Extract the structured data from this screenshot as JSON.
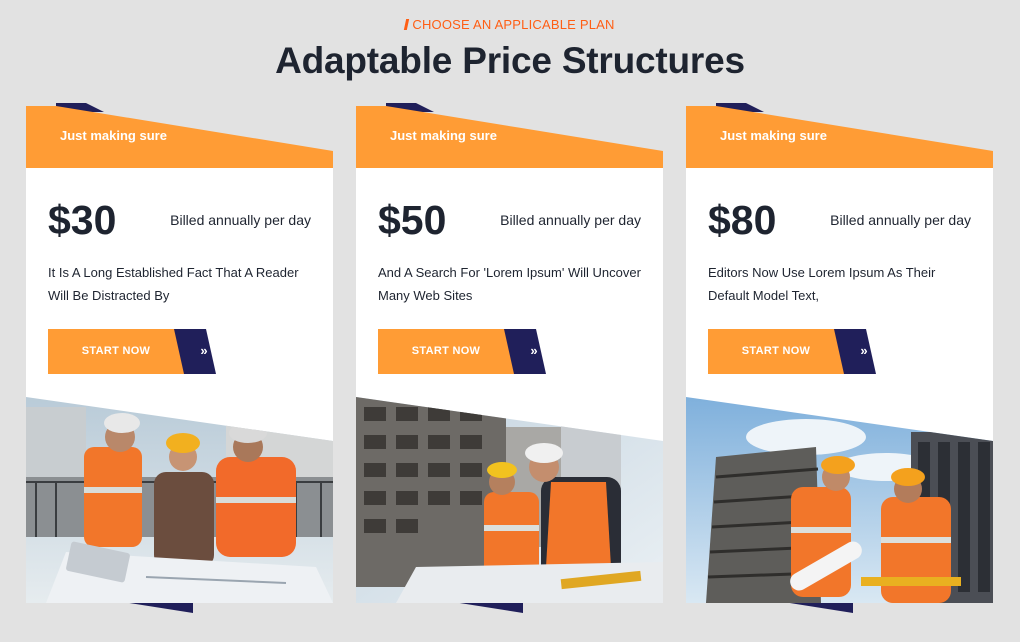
{
  "section": {
    "eyebrow": "CHOOSE AN APPLICABLE PLAN",
    "title": "Adaptable Price Structures"
  },
  "colors": {
    "accent_orange": "#ff9c35",
    "eyebrow_orange": "#ff5e14",
    "navy": "#201f5a",
    "text_dark": "#1e2430",
    "page_bg": "#e2e2e2"
  },
  "plans": [
    {
      "tag": "Just making sure",
      "price": "$30",
      "billing": "Billed annually per day",
      "description": "It Is A Long Established Fact That A Reader Will Be Distracted By",
      "button_label": "START NOW",
      "button_icon": "double-chevron-right-icon",
      "photo": "construction-workers-reviewing-blueprints"
    },
    {
      "tag": "Just making sure",
      "price": "$50",
      "billing": "Billed annually per day",
      "description": "And A Search For 'Lorem Ipsum' Will Uncover Many Web Sites",
      "button_label": "START NOW",
      "button_icon": "double-chevron-right-icon",
      "photo": "engineers-at-building-site"
    },
    {
      "tag": "Just making sure",
      "price": "$80",
      "billing": "Billed annually per day",
      "description": "Editors Now Use Lorem Ipsum As Their Default Model Text,",
      "button_label": "START NOW",
      "button_icon": "double-chevron-right-icon",
      "photo": "workers-with-plans-and-level"
    }
  ]
}
